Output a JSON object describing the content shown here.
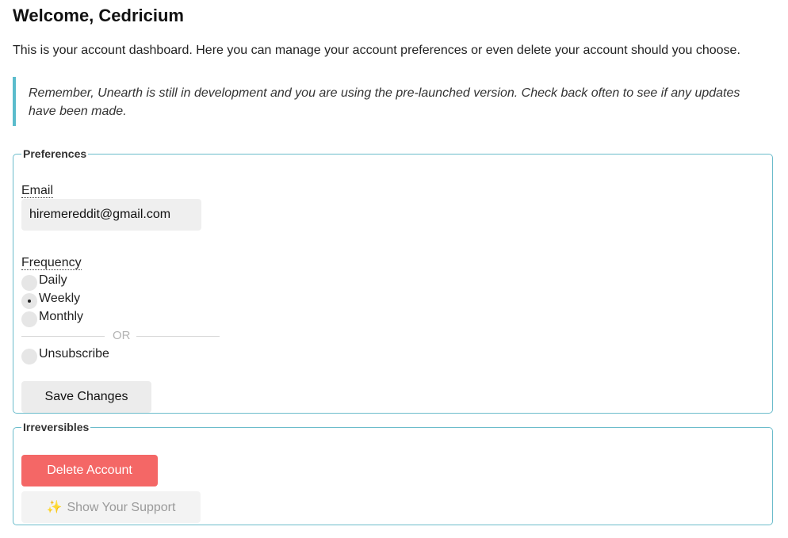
{
  "header": {
    "title": "Welcome, Cedricium",
    "intro": "This is your account dashboard. Here you can manage your account preferences or even delete your account should you choose."
  },
  "callout": {
    "text": "Remember, Unearth is still in development and you are using the pre-launched version. Check back often to see if any updates have been made."
  },
  "preferences": {
    "legend": "Preferences",
    "email_label": "Email",
    "email_value": "hiremereddit@gmail.com",
    "frequency_label": "Frequency",
    "options": [
      {
        "label": "Daily",
        "checked": false
      },
      {
        "label": "Weekly",
        "checked": true
      },
      {
        "label": "Monthly",
        "checked": false
      }
    ],
    "or_text": "OR",
    "unsubscribe_label": "Unsubscribe",
    "save_label": "Save Changes"
  },
  "irreversibles": {
    "legend": "Irreversibles",
    "delete_label": "Delete Account",
    "support_icon": "sparkles-icon",
    "support_label": "Show Your Support"
  },
  "colors": {
    "accent": "#5bbccc",
    "danger": "#f46766"
  }
}
